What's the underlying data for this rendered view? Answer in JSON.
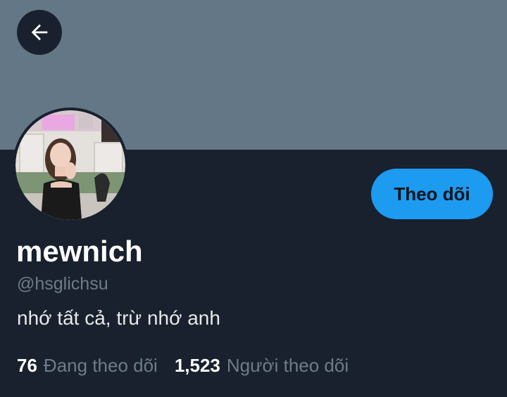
{
  "header": {
    "back_icon": "arrow-left-icon",
    "banner_color": "#647787"
  },
  "profile": {
    "avatar_icon": "profile-photo",
    "display_name": "mewnich",
    "handle": "@hsglichsu",
    "bio": "nhớ tất cả, trừ nhớ anh",
    "follow_button_label": "Theo dõi",
    "accent_color": "#1d9bf0"
  },
  "stats": {
    "following_count": "76",
    "following_label": "Đang theo dõi",
    "followers_count": "1,523",
    "followers_label": "Người theo dõi"
  }
}
